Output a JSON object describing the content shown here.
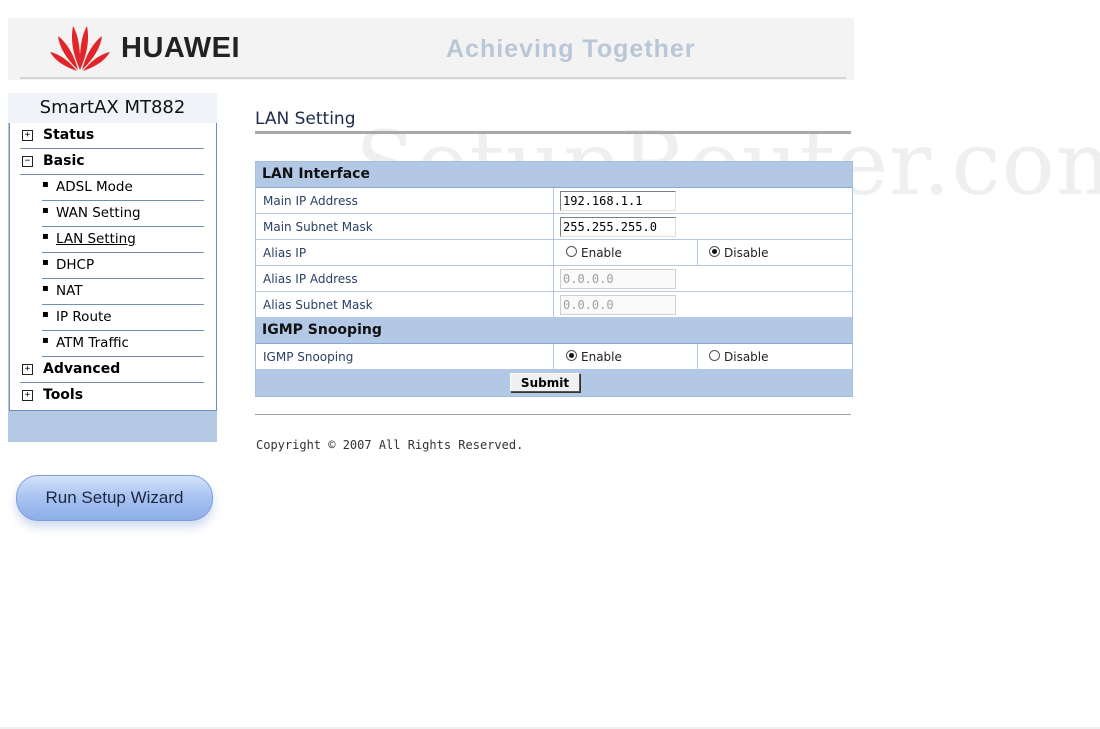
{
  "header": {
    "brand": "HUAWEI",
    "slogan": "Achieving Together",
    "logo_icon": "huawei-petals-icon",
    "logo_color": "#e0262a"
  },
  "watermark": "SetupRouter.com",
  "sidebar": {
    "title": "SmartAX MT882",
    "items": [
      {
        "label": "Status",
        "toggle": "+"
      },
      {
        "label": "Basic",
        "toggle": "−"
      },
      {
        "label": "ADSL Mode",
        "bullet": "▪"
      },
      {
        "label": "WAN Setting",
        "bullet": "▪"
      },
      {
        "label": "LAN Setting",
        "bullet": "▪",
        "active": true
      },
      {
        "label": "DHCP",
        "bullet": "▪"
      },
      {
        "label": "NAT",
        "bullet": "▪"
      },
      {
        "label": "IP Route",
        "bullet": "▪"
      },
      {
        "label": "ATM Traffic",
        "bullet": "▪"
      },
      {
        "label": "Advanced",
        "toggle": "+"
      },
      {
        "label": "Tools",
        "toggle": "+"
      }
    ],
    "accent_color": "#b4c9e3"
  },
  "wizard": {
    "label": "Run Setup Wizard"
  },
  "main": {
    "title": "LAN Setting",
    "lan_section": "LAN Interface",
    "fields": {
      "main_ip_label": "Main IP Address",
      "main_ip_value": "192.168.1.1",
      "main_mask_label": "Main Subnet Mask",
      "main_mask_value": "255.255.255.0",
      "alias_ip_label": "Alias IP",
      "alias_ip_enable": "Enable",
      "alias_ip_disable": "Disable",
      "alias_ip_selected": "Disable",
      "alias_addr_label": "Alias IP Address",
      "alias_addr_value": "0.0.0.0",
      "alias_mask_label": "Alias Subnet Mask",
      "alias_mask_value": "0.0.0.0"
    },
    "igmp_section": "IGMP Snooping",
    "igmp": {
      "label": "IGMP Snooping",
      "enable": "Enable",
      "disable": "Disable",
      "selected": "Enable"
    },
    "submit_label": "Submit",
    "copyright": "Copyright © 2007 All Rights Reserved."
  }
}
